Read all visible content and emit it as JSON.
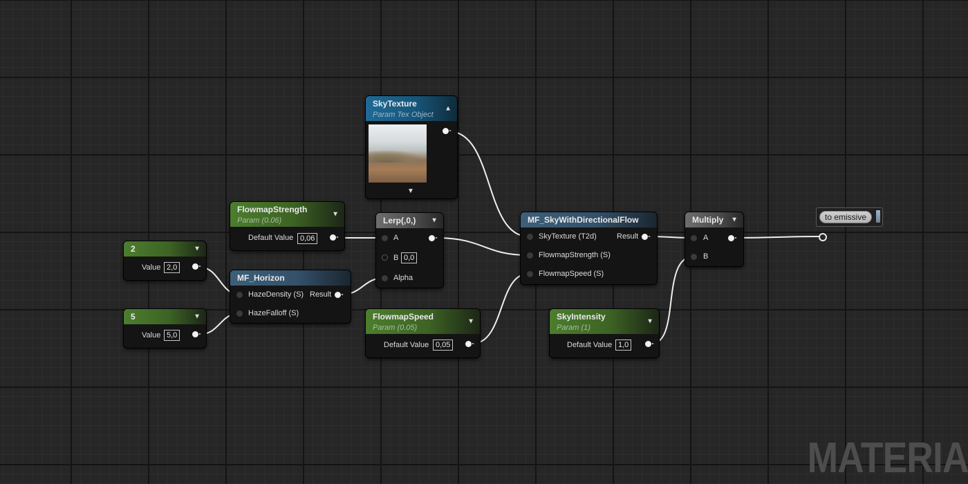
{
  "graph": {
    "watermark": "MATERIAL",
    "nodes": {
      "sky_texture": {
        "title": "SkyTexture",
        "subtitle": "Param Tex Object"
      },
      "flowmap_strength": {
        "title": "FlowmapStrength",
        "subtitle": "Param (0.06)",
        "row_label": "Default Value",
        "value": "0,06"
      },
      "lerp": {
        "title": "Lerp(,0,)",
        "pin_a": "A",
        "pin_b": "B",
        "pin_b_value": "0,0",
        "pin_alpha": "Alpha"
      },
      "mf_sky": {
        "title": "MF_SkyWithDirectionalFlow",
        "in1": "SkyTexture (T2d)",
        "in2": "FlowmapStrength (S)",
        "in3": "FlowmapSpeed (S)",
        "out": "Result"
      },
      "multiply": {
        "title": "Multiply",
        "pin_a": "A",
        "pin_b": "B"
      },
      "const_2": {
        "title": "2",
        "row_label": "Value",
        "value": "2,0"
      },
      "const_5": {
        "title": "5",
        "row_label": "Value",
        "value": "5,0"
      },
      "mf_horizon": {
        "title": "MF_Horizon",
        "in1": "HazeDensity (S)",
        "in2": "HazeFalloff (S)",
        "out": "Result"
      },
      "flowmap_speed": {
        "title": "FlowmapSpeed",
        "subtitle": "Param (0.05)",
        "row_label": "Default Value",
        "value": "0,05"
      },
      "sky_intensity": {
        "title": "SkyIntensity",
        "subtitle": "Param (1)",
        "row_label": "Default Value",
        "value": "1,0"
      },
      "reroute": {
        "label": "to emissive"
      }
    }
  },
  "colors": {
    "param_header": "#4c7d2e",
    "function_header": "#3d5f78",
    "texture_header": "#1f6a96",
    "math_header": "#6e6e6e",
    "wire": "#f0f0f0"
  },
  "icons": [
    "chevron-down-icon",
    "chevron-up-icon",
    "output-pin-icon",
    "input-pin-icon",
    "reroute-pin-icon"
  ]
}
